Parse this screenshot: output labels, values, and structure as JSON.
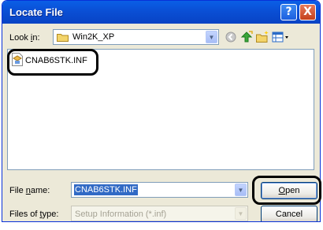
{
  "window": {
    "title": "Locate File"
  },
  "title_buttons": {
    "help": "?",
    "close": "X"
  },
  "look_in": {
    "label_pre": "Look ",
    "label_key": "i",
    "label_post": "n:",
    "value": "Win2K_XP"
  },
  "file_list": [
    {
      "name": "CNAB6STK.INF",
      "icon": "inf-file-icon"
    }
  ],
  "file_name": {
    "label_pre": "File ",
    "label_key": "n",
    "label_post": "ame:",
    "value": "CNAB6STK.INF"
  },
  "files_of_type": {
    "label_pre": "Files of ",
    "label_key": "t",
    "label_post": "ype:",
    "value": "Setup Information (*.inf)"
  },
  "buttons": {
    "open_key": "O",
    "open_rest": "pen",
    "cancel": "Cancel"
  },
  "icons": [
    "folder-icon",
    "back-icon",
    "up-folder-icon",
    "new-folder-icon",
    "view-menu-icon"
  ]
}
